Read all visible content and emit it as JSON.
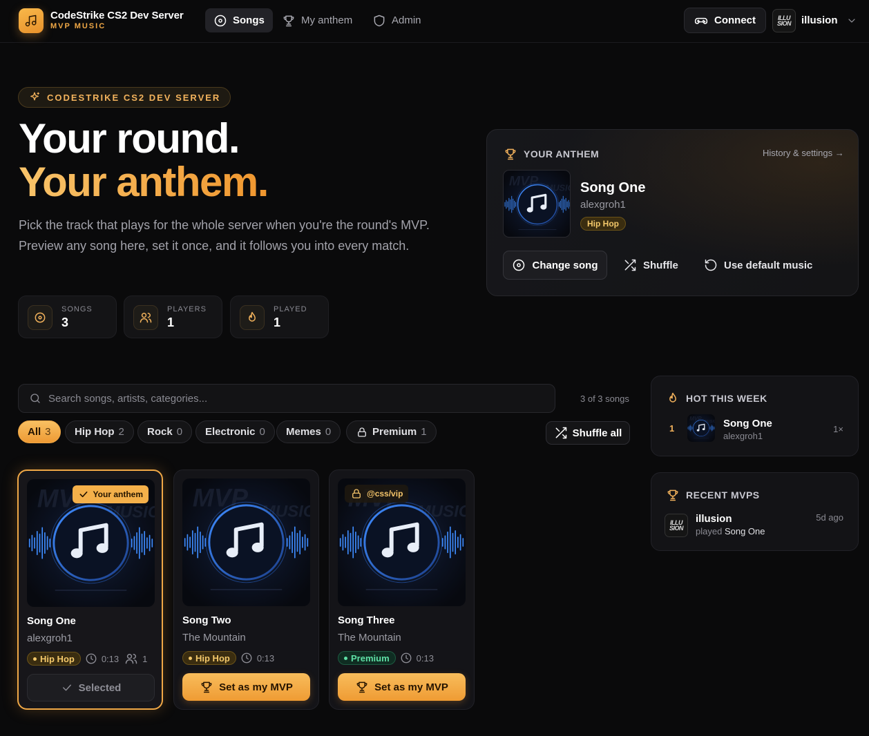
{
  "header": {
    "brand_title": "CodeStrike CS2 Dev Server",
    "brand_sub": "MVP MUSIC",
    "nav": [
      {
        "label": "Songs",
        "icon": "disc-icon",
        "active": true
      },
      {
        "label": "My anthem",
        "icon": "trophy-icon",
        "active": false
      },
      {
        "label": "Admin",
        "icon": "shield-icon",
        "active": false
      }
    ],
    "connect_label": "Connect",
    "user": {
      "name": "illusion",
      "avatar_text": "ILLU SION"
    }
  },
  "hero": {
    "tag": "CODESTRIKE CS2 DEV SERVER",
    "line1": "Your round.",
    "line2": "Your anthem.",
    "description": "Pick the track that plays for the whole server when you're the round's MVP. Preview any song here, set it once, and it follows you into every match."
  },
  "stats": [
    {
      "label": "SONGS",
      "value": "3",
      "icon": "disc-icon"
    },
    {
      "label": "PLAYERS",
      "value": "1",
      "icon": "users-icon"
    },
    {
      "label": "PLAYED",
      "value": "1",
      "icon": "flame-icon"
    }
  ],
  "anthem": {
    "heading": "YOUR ANTHEM",
    "history_link": "History & settings →",
    "title": "Song One",
    "artist": "alexgroh1",
    "genre": "Hip Hop",
    "change_label": "Change song",
    "shuffle_label": "Shuffle",
    "default_label": "Use default music"
  },
  "search": {
    "placeholder": "Search songs, artists, categories...",
    "count_text": "3 of 3 songs"
  },
  "filters": [
    {
      "label": "All",
      "count": "3",
      "active": true
    },
    {
      "label": "Hip Hop",
      "count": "2",
      "active": false
    },
    {
      "label": "Rock",
      "count": "0",
      "active": false
    },
    {
      "label": "Electronic",
      "count": "0",
      "active": false
    },
    {
      "label": "Memes",
      "count": "0",
      "active": false
    },
    {
      "label": "Premium",
      "count": "1",
      "active": false,
      "icon": "lock-icon"
    }
  ],
  "shuffle_all_label": "Shuffle all",
  "songs": [
    {
      "title": "Song One",
      "artist": "alexgroh1",
      "genre": "Hip Hop",
      "duration": "0:13",
      "players": "1",
      "overlay": "Your anthem",
      "action": "Selected",
      "selected": true
    },
    {
      "title": "Song Two",
      "artist": "The Mountain",
      "genre": "Hip Hop",
      "duration": "0:13",
      "action": "Set as my MVP",
      "selected": false
    },
    {
      "title": "Song Three",
      "artist": "The Mountain",
      "genre": "Premium",
      "duration": "0:13",
      "overlay": "@css/vip",
      "action": "Set as my MVP",
      "selected": false
    }
  ],
  "hot": {
    "heading": "HOT THIS WEEK",
    "items": [
      {
        "rank": "1",
        "title": "Song One",
        "artist": "alexgroh1",
        "plays": "1×"
      }
    ]
  },
  "recent": {
    "heading": "RECENT MVPS",
    "items": [
      {
        "user": "illusion",
        "played_prefix": "played",
        "song": "Song One",
        "time": "5d ago"
      }
    ]
  },
  "colors": {
    "accent": "#f0a846",
    "background": "#0a0a0b",
    "premium": "#5fe0a6"
  }
}
